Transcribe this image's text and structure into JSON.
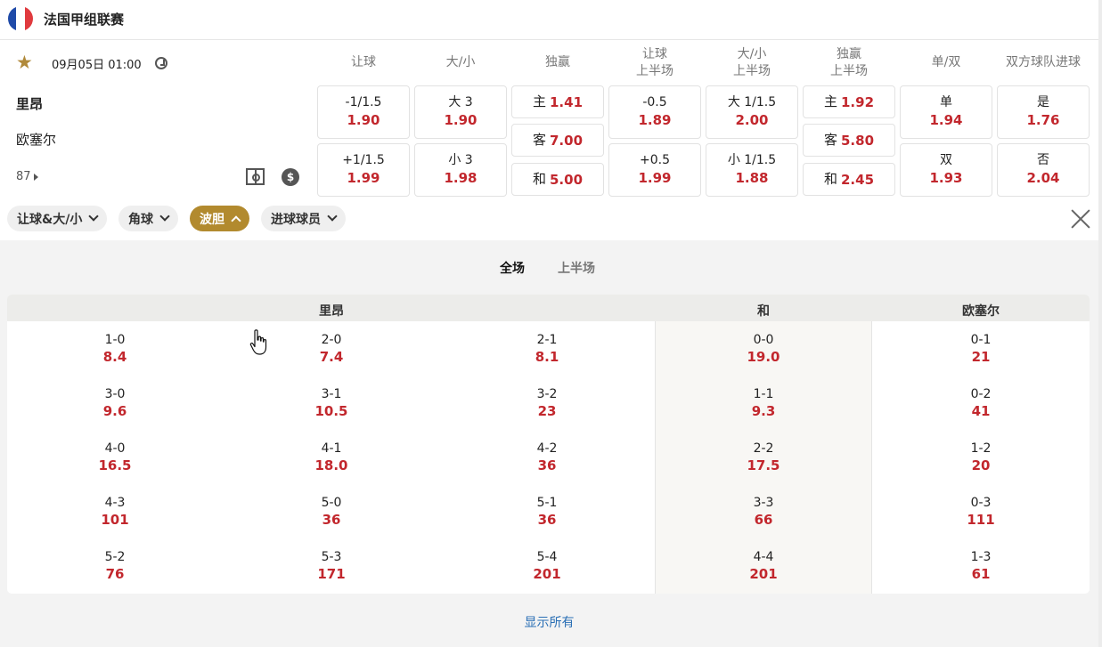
{
  "league": {
    "name": "法国甲组联赛",
    "flag_colors": [
      "#1f4aa8",
      "#ffffff",
      "#e03a3e"
    ]
  },
  "match": {
    "time": "09月05日 01:00",
    "home": "里昂",
    "away": "欧塞尔",
    "more_markets": "87"
  },
  "markets": [
    {
      "title": [
        "让球"
      ]
    },
    {
      "title": [
        "大/小"
      ]
    },
    {
      "title": [
        "独赢"
      ]
    },
    {
      "title": [
        "让球",
        "上半场"
      ]
    },
    {
      "title": [
        "大/小",
        "上半场"
      ]
    },
    {
      "title": [
        "独赢",
        "上半场"
      ]
    },
    {
      "title": [
        "单/双"
      ]
    },
    {
      "title": [
        "双方球队进球"
      ]
    }
  ],
  "odds": {
    "handicap": [
      {
        "label": "-1/1.5",
        "odd": "1.90"
      },
      {
        "label": "+1/1.5",
        "odd": "1.99"
      }
    ],
    "overunder": [
      {
        "label": "大 3",
        "odd": "1.90"
      },
      {
        "label": "小 3",
        "odd": "1.98"
      }
    ],
    "moneyline": [
      {
        "label": "主",
        "odd": "1.41"
      },
      {
        "label": "客",
        "odd": "7.00"
      },
      {
        "label": "和",
        "odd": "5.00"
      }
    ],
    "handicap_1h": [
      {
        "label": "-0.5",
        "odd": "1.89"
      },
      {
        "label": "+0.5",
        "odd": "1.99"
      }
    ],
    "overunder_1h": [
      {
        "label": "大 1/1.5",
        "odd": "2.00"
      },
      {
        "label": "小 1/1.5",
        "odd": "1.88"
      }
    ],
    "moneyline_1h": [
      {
        "label": "主",
        "odd": "1.92"
      },
      {
        "label": "客",
        "odd": "5.80"
      },
      {
        "label": "和",
        "odd": "2.45"
      }
    ],
    "oddeven": [
      {
        "label": "单",
        "odd": "1.94"
      },
      {
        "label": "双",
        "odd": "1.93"
      }
    ],
    "btts": [
      {
        "label": "是",
        "odd": "1.76"
      },
      {
        "label": "否",
        "odd": "2.04"
      }
    ]
  },
  "filters": [
    {
      "label": "让球&大/小",
      "active": false
    },
    {
      "label": "角球",
      "active": false
    },
    {
      "label": "波胆",
      "active": true
    },
    {
      "label": "进球球员",
      "active": false
    }
  ],
  "period_tabs": {
    "full": "全场",
    "first_half": "上半场"
  },
  "correct_score": {
    "headers": {
      "home": "里昂",
      "draw": "和",
      "away": "欧塞尔"
    },
    "home": [
      [
        {
          "s": "1-0",
          "o": "8.4"
        },
        {
          "s": "2-0",
          "o": "7.4"
        },
        {
          "s": "2-1",
          "o": "8.1"
        }
      ],
      [
        {
          "s": "3-0",
          "o": "9.6"
        },
        {
          "s": "3-1",
          "o": "10.5"
        },
        {
          "s": "3-2",
          "o": "23"
        }
      ],
      [
        {
          "s": "4-0",
          "o": "16.5"
        },
        {
          "s": "4-1",
          "o": "18.0"
        },
        {
          "s": "4-2",
          "o": "36"
        }
      ],
      [
        {
          "s": "4-3",
          "o": "101"
        },
        {
          "s": "5-0",
          "o": "36"
        },
        {
          "s": "5-1",
          "o": "36"
        }
      ],
      [
        {
          "s": "5-2",
          "o": "76"
        },
        {
          "s": "5-3",
          "o": "171"
        },
        {
          "s": "5-4",
          "o": "201"
        }
      ]
    ],
    "draw": [
      {
        "s": "0-0",
        "o": "19.0"
      },
      {
        "s": "1-1",
        "o": "9.3"
      },
      {
        "s": "2-2",
        "o": "17.5"
      },
      {
        "s": "3-3",
        "o": "66"
      },
      {
        "s": "4-4",
        "o": "201"
      }
    ],
    "away": [
      {
        "s": "0-1",
        "o": "21"
      },
      {
        "s": "0-2",
        "o": "41"
      },
      {
        "s": "1-2",
        "o": "20"
      },
      {
        "s": "0-3",
        "o": "111"
      },
      {
        "s": "1-3",
        "o": "61"
      }
    ]
  },
  "show_all": "显示所有",
  "colors": {
    "accent": "#b28a2e",
    "odds": "#c2272d",
    "link": "#2a6fb5"
  }
}
